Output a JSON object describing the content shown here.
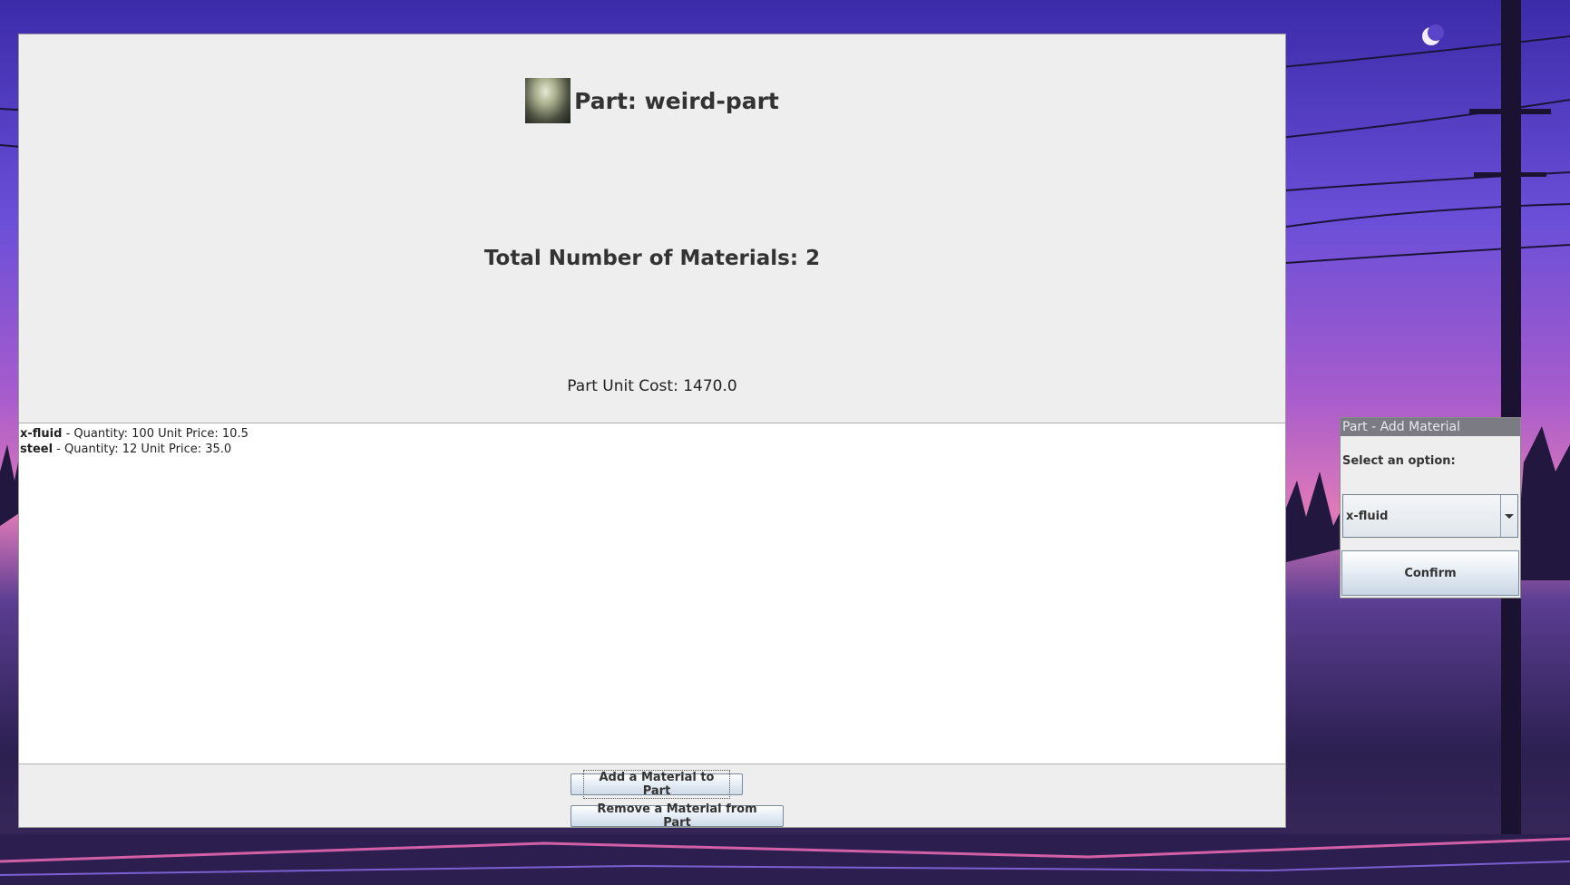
{
  "main_window": {
    "part_title": "Part: weird-part",
    "part_image_icon": "part-image",
    "materials_count": "Total Number of Materials: 2",
    "unit_cost": "Part Unit Cost: 1470.0",
    "materials": [
      {
        "name": "x-fluid",
        "details": "Quantity: 100 Unit Price: 10.5"
      },
      {
        "name": "steel",
        "details": "Quantity: 12 Unit Price: 35.0"
      }
    ],
    "add_button": "Add a Material to Part",
    "remove_button": "Remove a Material from Part"
  },
  "dialog": {
    "title": "Part - Add Material",
    "prompt": "Select an option:",
    "selected_option": "x-fluid",
    "confirm_button": "Confirm"
  },
  "colors": {
    "window_background": "#eeeeee",
    "dialog_titlebar": "#7b7b84",
    "list_background": "#ffffff"
  }
}
